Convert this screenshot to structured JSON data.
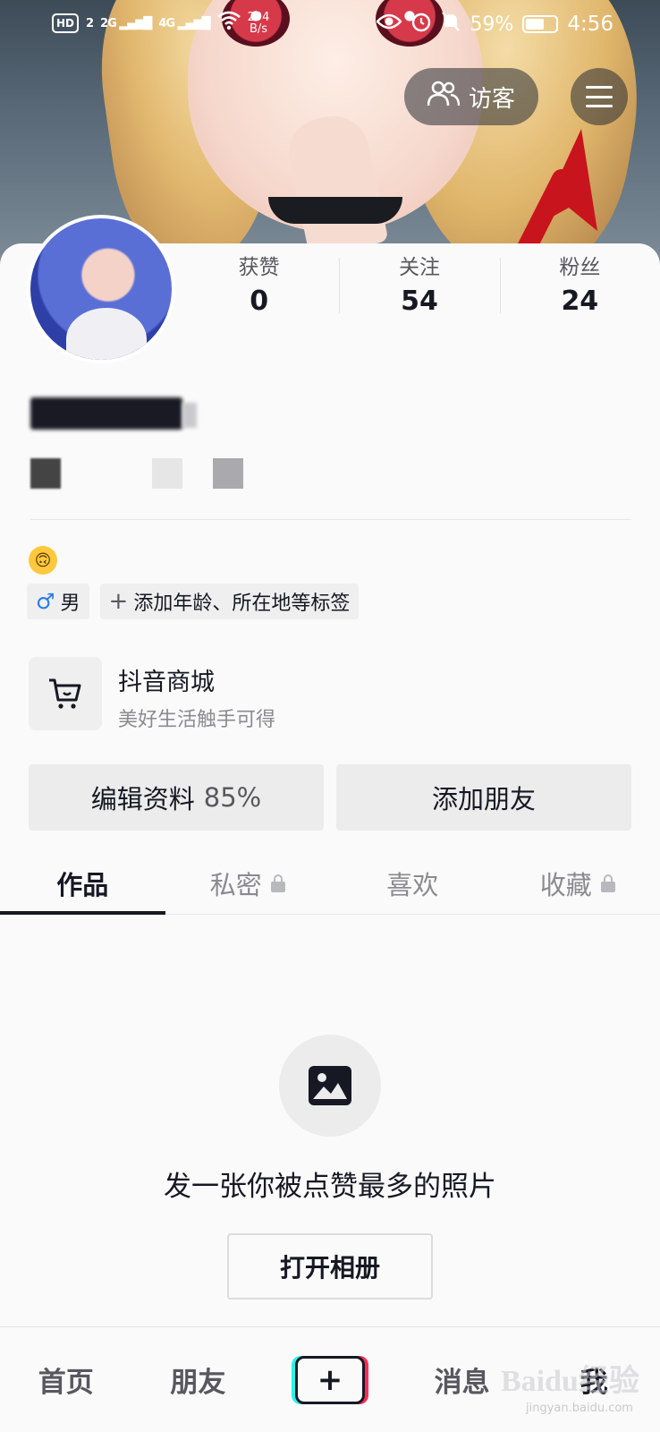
{
  "status_bar": {
    "hd": "HD",
    "sim": "2",
    "net1": "2G",
    "net2": "4G",
    "rate_value": "294",
    "rate_unit": "B/s",
    "battery": "59%",
    "time": "4:56"
  },
  "header": {
    "visitor_label": "访客",
    "menu_icon": "hamburger-menu-icon"
  },
  "stats": [
    {
      "label": "获赞",
      "value": "0"
    },
    {
      "label": "关注",
      "value": "54"
    },
    {
      "label": "粉丝",
      "value": "24"
    }
  ],
  "profile": {
    "emoji": "🙃",
    "tags": [
      {
        "icon": "♂",
        "label": "男"
      },
      {
        "icon": "+",
        "label": "添加年龄、所在地等标签"
      }
    ]
  },
  "shop": {
    "title": "抖音商城",
    "subtitle": "美好生活触手可得"
  },
  "actions": {
    "edit_label": "编辑资料",
    "edit_percent": "85%",
    "add_friends_label": "添加朋友"
  },
  "tabs": [
    {
      "label": "作品",
      "active": true,
      "locked": false
    },
    {
      "label": "私密",
      "active": false,
      "locked": true
    },
    {
      "label": "喜欢",
      "active": false,
      "locked": false
    },
    {
      "label": "收藏",
      "active": false,
      "locked": true
    }
  ],
  "empty_state": {
    "message": "发一张你被点赞最多的照片",
    "button": "打开相册"
  },
  "bottom_nav": {
    "home": "首页",
    "friends": "朋友",
    "plus": "+",
    "messages": "消息",
    "me": "我"
  },
  "watermark": {
    "brand": "Baidu经验",
    "url": "jingyan.baidu.com"
  },
  "colors": {
    "annotation_arrow": "#c8141c",
    "accent_cyan": "#25f4ee",
    "accent_red": "#fe2c55",
    "text_primary": "#161823"
  }
}
